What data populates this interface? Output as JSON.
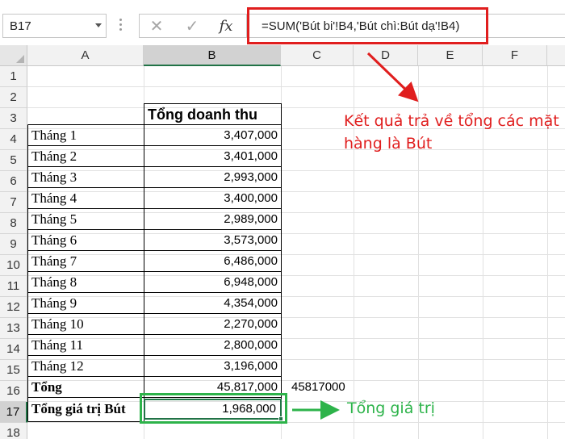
{
  "name_box": {
    "value": "B17"
  },
  "formula_bar": {
    "cancel_icon": "close-icon",
    "enter_icon": "check-icon",
    "fx_label": "fx",
    "formula": "=SUM('Bút bi'!B4,'Bút chì:Bút dạ'!B4)"
  },
  "columns": [
    "A",
    "B",
    "C",
    "D",
    "E",
    "F"
  ],
  "rows": [
    "1",
    "2",
    "3",
    "4",
    "5",
    "6",
    "7",
    "8",
    "9",
    "10",
    "11",
    "12",
    "13",
    "14",
    "15",
    "16",
    "17",
    "18"
  ],
  "table": {
    "header": "Tổng doanh thu",
    "months": [
      {
        "label": "Tháng 1",
        "value": "3,407,000"
      },
      {
        "label": "Tháng 2",
        "value": "3,401,000"
      },
      {
        "label": "Tháng 3",
        "value": "2,993,000"
      },
      {
        "label": "Tháng 4",
        "value": "3,400,000"
      },
      {
        "label": "Tháng 5",
        "value": "2,989,000"
      },
      {
        "label": "Tháng 6",
        "value": "3,573,000"
      },
      {
        "label": "Tháng 7",
        "value": "6,486,000"
      },
      {
        "label": "Tháng 8",
        "value": "6,948,000"
      },
      {
        "label": "Tháng 9",
        "value": "4,354,000"
      },
      {
        "label": "Tháng 10",
        "value": "2,270,000"
      },
      {
        "label": "Tháng 11",
        "value": "2,800,000"
      },
      {
        "label": "Tháng 12",
        "value": "3,196,000"
      }
    ],
    "total_label": "Tổng",
    "total_value": "45,817,000",
    "total_c": "45817000",
    "pen_total_label": "Tổng giá trị Bút",
    "pen_total_value": "1,968,000"
  },
  "annotations": {
    "red_text": "Kết quả trả về tổng các mặt hàng là Bút",
    "green_text": "Tổng giá trị",
    "red_color": "#e01e1e",
    "green_color": "#2db34a"
  }
}
